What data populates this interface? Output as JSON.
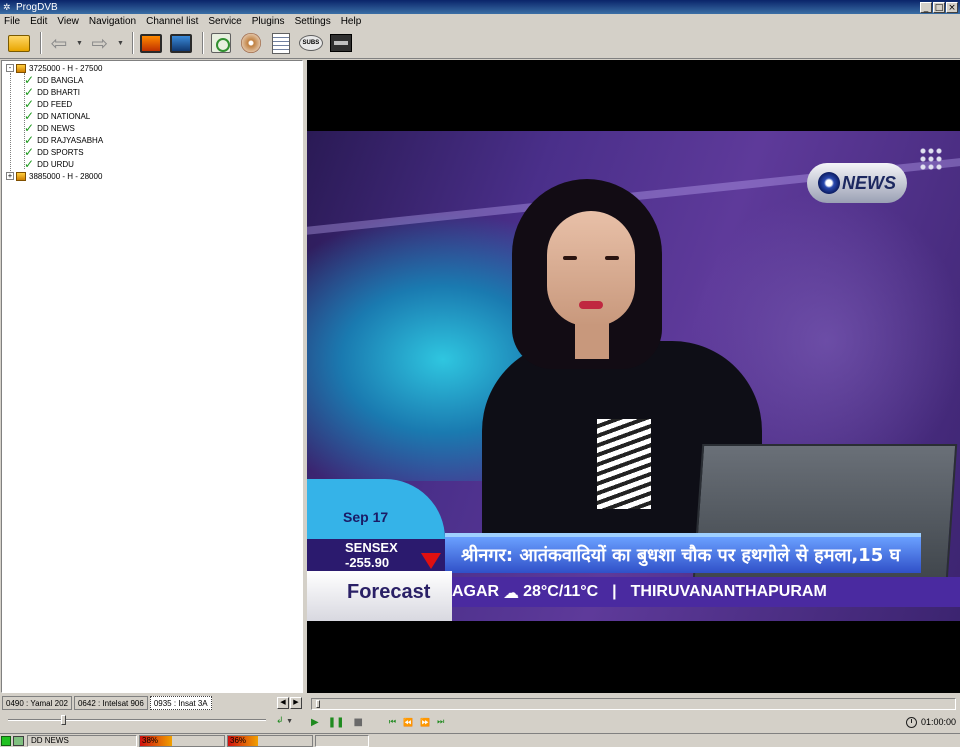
{
  "window": {
    "title": "ProgDVB",
    "controls": [
      "_",
      "□",
      "×"
    ]
  },
  "menu": [
    "File",
    "Edit",
    "View",
    "Navigation",
    "Channel list",
    "Service",
    "Plugins",
    "Settings",
    "Help"
  ],
  "toolbar": {
    "icons": [
      "open-folder-icon",
      "back-arrow-icon",
      "forward-arrow-icon",
      "tv-monitor-icon",
      "radio-monitor-icon",
      "scan-icon",
      "disc-icon",
      "epg-document-icon",
      "subs-icon",
      "recorder-icon"
    ],
    "subs_label": "SUBS"
  },
  "tree": {
    "transponders": [
      {
        "label": "3725000 - H - 27500",
        "expanded": true,
        "expander": "-",
        "channels": [
          "DD BANGLA",
          "DD BHARTI",
          "DD FEED",
          "DD NATIONAL",
          "DD NEWS",
          "DD RAJYASABHA",
          "DD SPORTS",
          "DD URDU"
        ]
      },
      {
        "label": "3885000 - H - 28000",
        "expanded": false,
        "expander": "+",
        "channels": []
      }
    ]
  },
  "satellite_tabs": [
    {
      "label": "0490 : Yamal 202",
      "active": false
    },
    {
      "label": "0642 : Intelsat 906",
      "active": false
    },
    {
      "label": "0935 : Insat 3A",
      "active": true
    }
  ],
  "video": {
    "logo_text": "NEWS",
    "date": "Sep 17",
    "sensex_label": "SENSEX",
    "sensex_value": "-255.90",
    "headline": "श्रीनगर: आतंकवादियों का बुधशा चौक पर हथगोले से हमला,15 घ",
    "forecast_label": "Forecast",
    "ticker_city_a": "AGAR",
    "ticker_temp": "28°C/11°C",
    "ticker_sep": "|",
    "ticker_city_b": "THIRUVANANTHAPURAM"
  },
  "playback": {
    "time": "01:00:00",
    "buttons": [
      "play-icon",
      "pause-icon",
      "stop-icon",
      "skip-back-icon",
      "rewind-icon",
      "fast-forward-icon",
      "skip-forward-icon"
    ],
    "position_fraction": 0.0
  },
  "volume": {
    "level_fraction": 0.21
  },
  "status": {
    "channel": "DD NEWS",
    "signal_level": "38%",
    "signal_fraction": 0.38,
    "quality": "36%",
    "quality_fraction": 0.36
  }
}
